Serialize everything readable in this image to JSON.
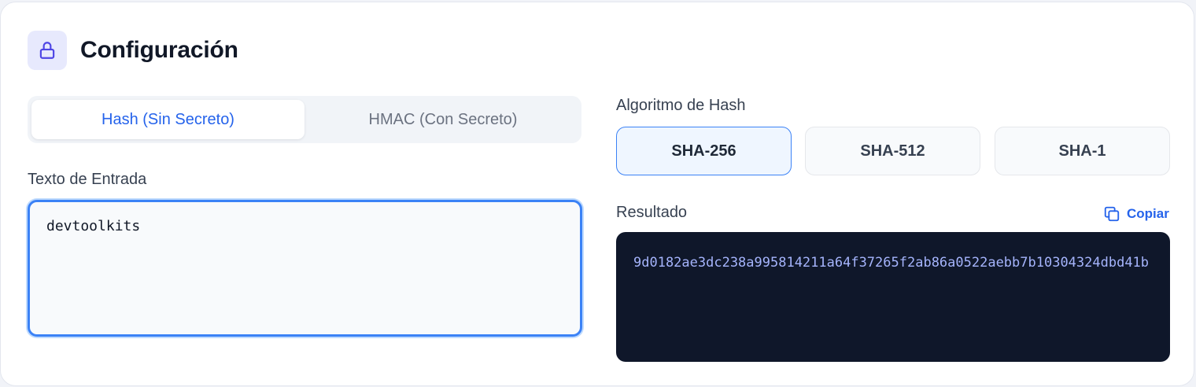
{
  "header": {
    "title": "Configuración",
    "icon": "lock-icon"
  },
  "mode_tabs": {
    "items": [
      {
        "label": "Hash (Sin Secreto)",
        "active": true
      },
      {
        "label": "HMAC (Con Secreto)",
        "active": false
      }
    ]
  },
  "input": {
    "label": "Texto de Entrada",
    "value": "devtoolkits"
  },
  "algorithm": {
    "label": "Algoritmo de Hash",
    "options": [
      {
        "label": "SHA-256",
        "selected": true
      },
      {
        "label": "SHA-512",
        "selected": false
      },
      {
        "label": "SHA-1",
        "selected": false
      }
    ]
  },
  "result": {
    "label": "Resultado",
    "copy_label": "Copiar",
    "copy_icon": "copy-icon",
    "value": "9d0182ae3dc238a995814211a64f37265f2ab86a0522aebb7b10304324dbd41b"
  },
  "colors": {
    "accent": "#2563eb",
    "focus_border": "#3b82f6",
    "result_bg": "#0f172a",
    "result_text": "#a5b4fc",
    "icon_bg": "#e7e9fd",
    "icon_stroke": "#4f46e5"
  }
}
